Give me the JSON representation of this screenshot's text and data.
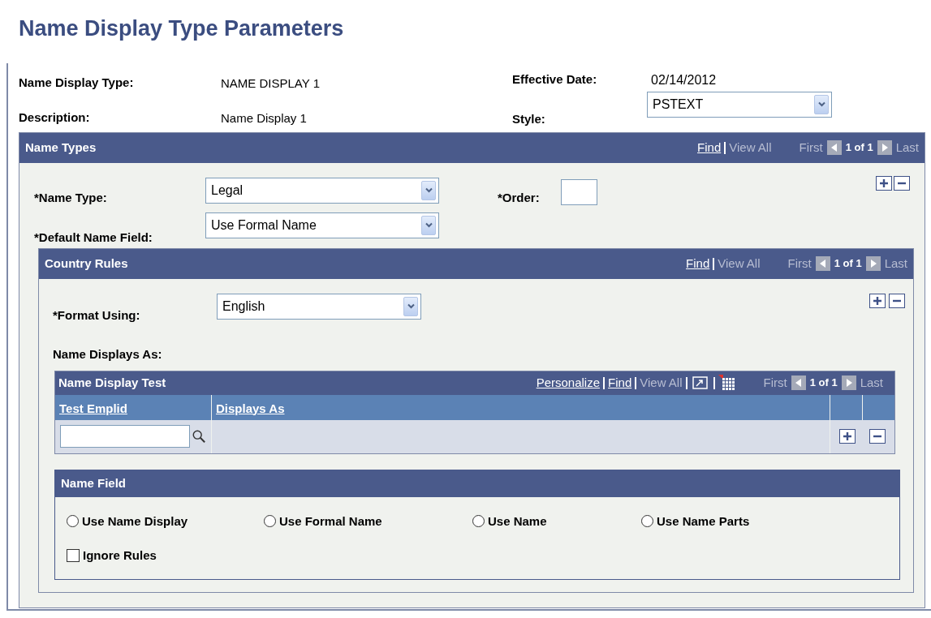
{
  "title": "Name Display Type Parameters",
  "header": {
    "name_display_type": {
      "label": "Name Display Type:",
      "value": "NAME DISPLAY 1"
    },
    "description": {
      "label": "Description:",
      "value": "Name Display 1"
    },
    "effective_date": {
      "label": "Effective Date:",
      "value": "02/14/2012"
    },
    "style": {
      "label": "Style:",
      "value": "PSTEXT"
    }
  },
  "name_types": {
    "title": "Name Types",
    "nav": {
      "links": [
        {
          "label": "Find",
          "disabled": false
        },
        {
          "label": "View All",
          "disabled": true
        }
      ],
      "first": {
        "label": "First",
        "disabled": true
      },
      "count": "1 of 1",
      "last": {
        "label": "Last",
        "disabled": true
      }
    },
    "name_type": {
      "label": "*Name Type:",
      "value": "Legal"
    },
    "order": {
      "label": "*Order:"
    },
    "default_name_field": {
      "label": "*Default Name Field:",
      "value": "Use Formal Name"
    },
    "country_rules": {
      "title": "Country Rules",
      "nav": {
        "links": [
          {
            "label": "Find",
            "disabled": false
          },
          {
            "label": "View All",
            "disabled": true
          }
        ],
        "first": {
          "label": "First",
          "disabled": true
        },
        "count": "1 of 1",
        "last": {
          "label": "Last",
          "disabled": true
        }
      },
      "format_using": {
        "label": "*Format Using:",
        "value": "English"
      },
      "name_displays_as": "Name Displays As:",
      "grid": {
        "title": "Name Display Test",
        "nav": {
          "links": [
            {
              "label": "Personalize",
              "disabled": false
            },
            {
              "label": "Find",
              "disabled": false
            },
            {
              "label": "View All",
              "disabled": true
            }
          ],
          "first": {
            "label": "First",
            "disabled": true
          },
          "count": "1 of 1",
          "last": {
            "label": "Last",
            "disabled": true
          }
        },
        "columns": [
          "Test Emplid",
          "Displays As"
        ]
      },
      "name_field": {
        "title": "Name Field",
        "options": [
          {
            "label": "Use Name Display",
            "selected": false
          },
          {
            "label": "Use Formal Name",
            "selected": false
          },
          {
            "label": "Use Name",
            "selected": false
          },
          {
            "label": "Use Name Parts",
            "selected": false
          }
        ],
        "ignore_rules": {
          "label": "Ignore Rules",
          "checked": false
        }
      }
    }
  }
}
